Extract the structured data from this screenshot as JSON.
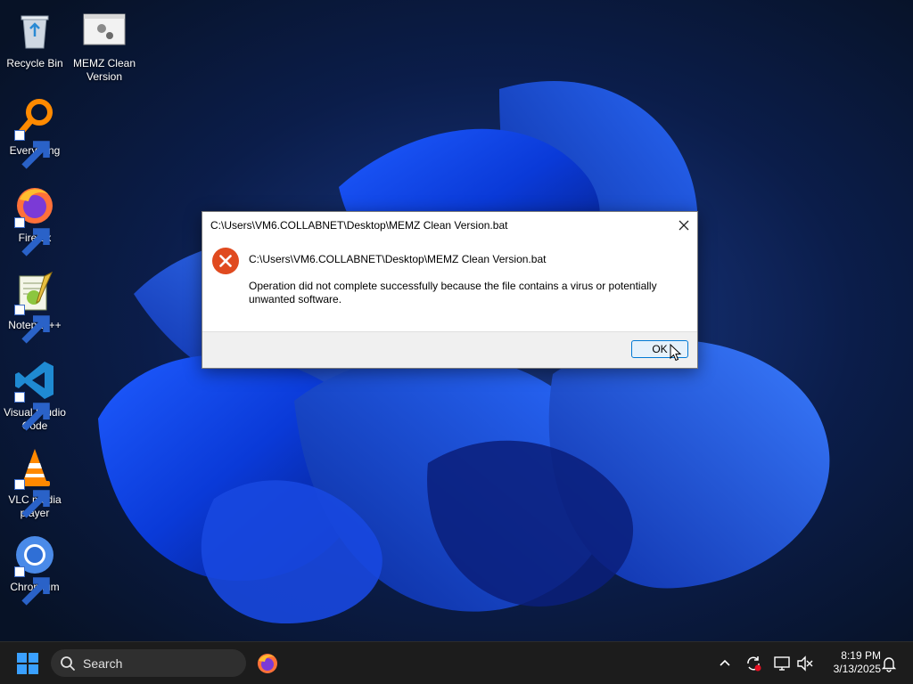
{
  "desktop": {
    "icons": [
      {
        "label_line1": "Recycle Bin",
        "label_line2": ""
      },
      {
        "label_line1": "MEMZ Clean",
        "label_line2": "Version"
      },
      {
        "label_line1": "Everything",
        "label_line2": ""
      },
      {
        "label_line1": "Firefox",
        "label_line2": ""
      },
      {
        "label_line1": "Notepad++",
        "label_line2": ""
      },
      {
        "label_line1": "Visual Studio",
        "label_line2": "Code"
      },
      {
        "label_line1": "VLC media",
        "label_line2": "player"
      },
      {
        "label_line1": "Chromium",
        "label_line2": ""
      }
    ]
  },
  "dialog": {
    "title": "C:\\Users\\VM6.COLLABNET\\Desktop\\MEMZ Clean Version.bat",
    "path": "C:\\Users\\VM6.COLLABNET\\Desktop\\MEMZ Clean Version.bat",
    "message": "Operation did not complete successfully because the file contains a virus or potentially unwanted software.",
    "ok_label": "OK",
    "icon": "error-icon",
    "accent_color": "#0078d4",
    "error_color": "#e04a1f"
  },
  "taskbar": {
    "search_placeholder": "Search",
    "time": "8:19 PM",
    "date": "3/13/2025",
    "background_color": "#1c1c1c"
  }
}
